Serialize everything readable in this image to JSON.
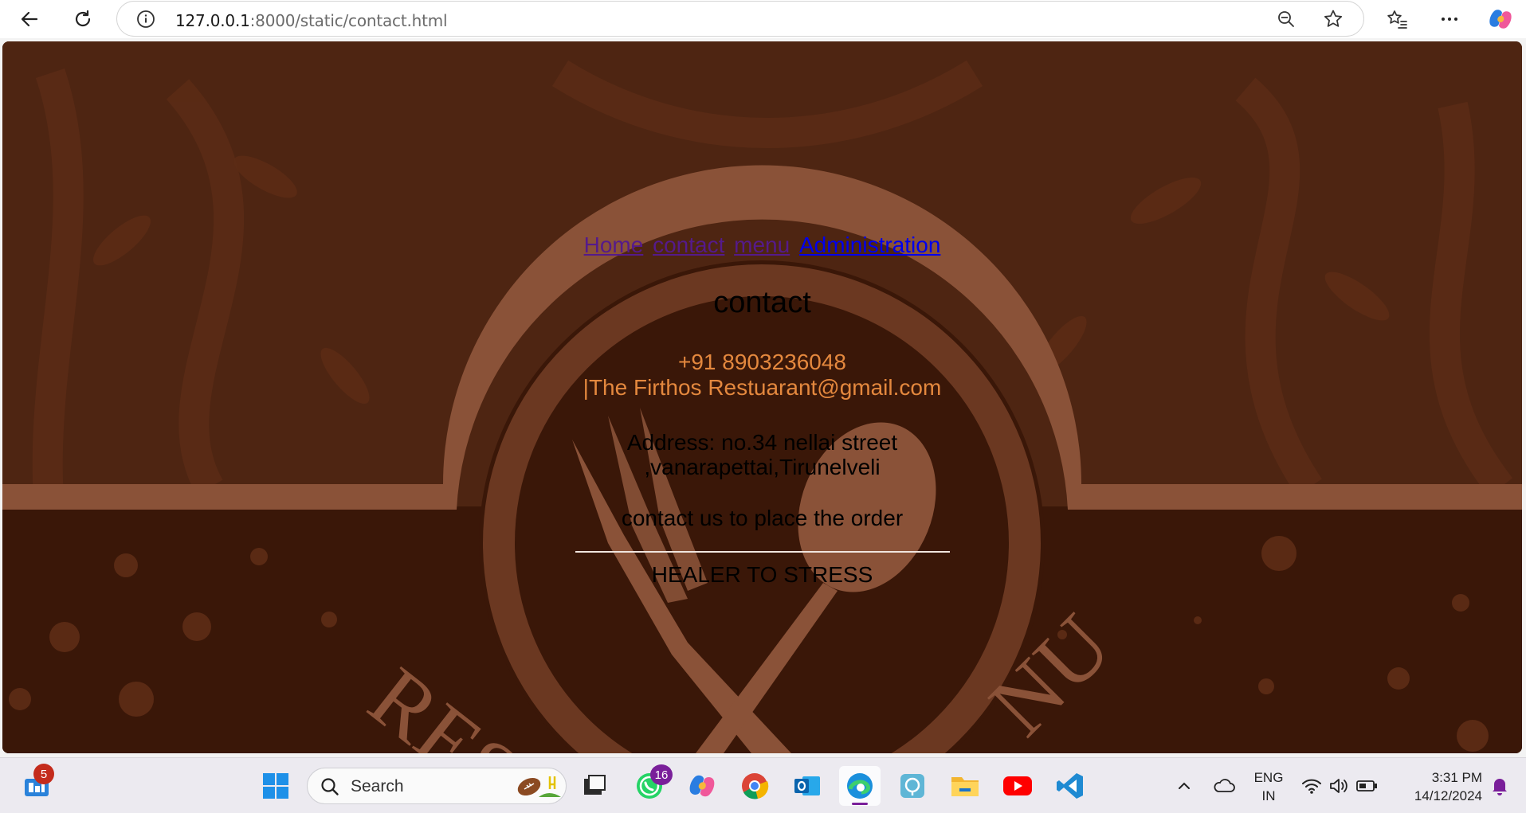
{
  "browser": {
    "url_host": "127.0.0.1",
    "url_path": ":8000/static/contact.html"
  },
  "page": {
    "nav": [
      {
        "label": "Home",
        "state": "visited"
      },
      {
        "label": "contact",
        "state": "visited"
      },
      {
        "label": "menu",
        "state": "visited"
      },
      {
        "label": "Administration",
        "state": "link"
      }
    ],
    "heading": "contact",
    "phone": "+91 8903236048",
    "email": "|The Firthos Restuarant@gmail.com",
    "address_line1": "Address: no.34 nellai street",
    "address_line2": ",vanarapettai,Tirunelveli",
    "order_text": "contact us to place the order",
    "slogan": "HEALER TO STRESS",
    "bg_text_left": "RES",
    "bg_text_right": "NU"
  },
  "taskbar": {
    "widgets_badge": "5",
    "search_placeholder": "Search",
    "whatsapp_badge": "16",
    "lang_line1": "ENG",
    "lang_line2": "IN",
    "time": "3:31 PM",
    "date": "14/12/2024"
  },
  "colors": {
    "page_bg": "#4e2512",
    "accent_orange": "#e4883e",
    "visited_link": "#551a8b",
    "link": "#0000ee"
  }
}
